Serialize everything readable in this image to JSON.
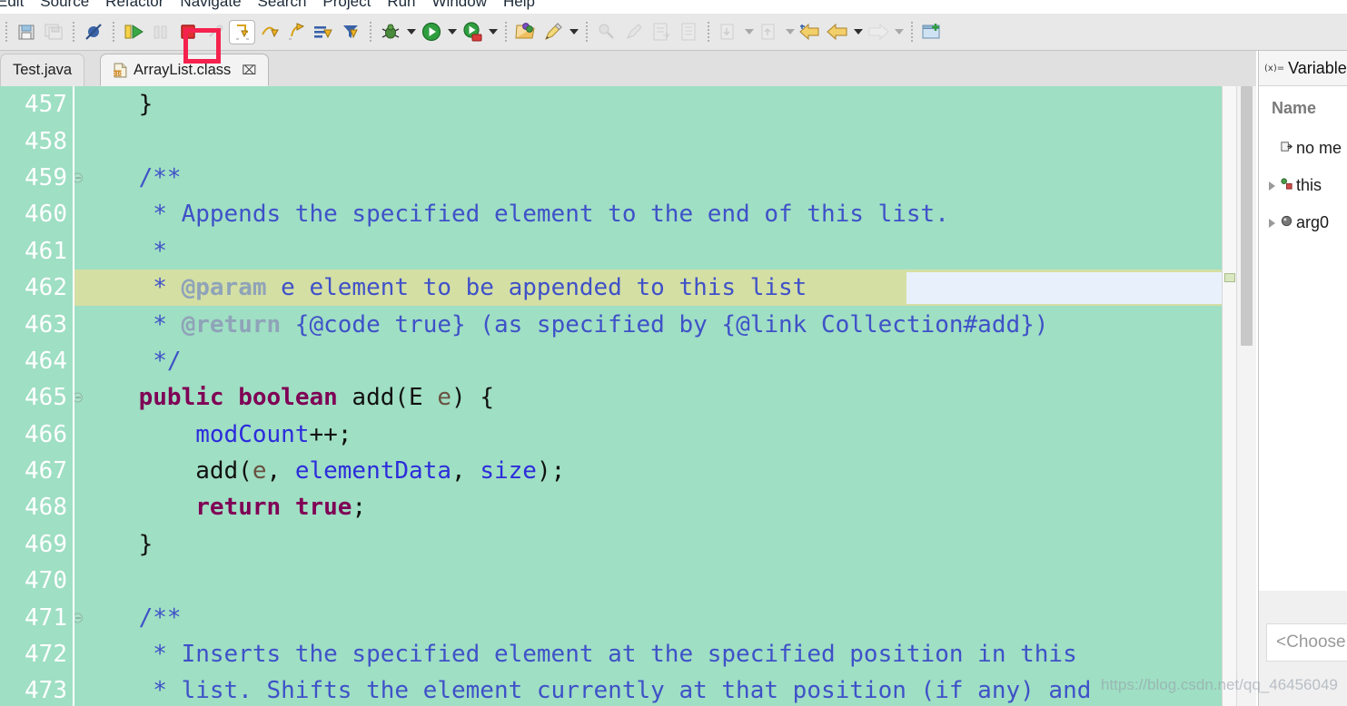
{
  "menu": {
    "items": [
      "Edit",
      "Source",
      "Refactor",
      "Navigate",
      "Search",
      "Project",
      "Run",
      "Window",
      "Help"
    ]
  },
  "toolbar": {
    "groups": [
      {
        "buttons": [
          {
            "name": "save-button",
            "icon": "save-icon",
            "enabled": true
          },
          {
            "name": "save-all-button",
            "icon": "save-all-icon",
            "enabled": false
          }
        ]
      },
      {
        "buttons": [
          {
            "name": "skip-all-breakpoints-button",
            "icon": "skip-breakpoints-icon",
            "enabled": true
          }
        ]
      },
      {
        "buttons": [
          {
            "name": "resume-button",
            "icon": "resume-icon",
            "enabled": true
          },
          {
            "name": "suspend-button",
            "icon": "suspend-icon",
            "enabled": false
          },
          {
            "name": "terminate-button",
            "icon": "terminate-icon",
            "enabled": true
          },
          {
            "name": "disconnect-button",
            "icon": "disconnect-icon",
            "enabled": false
          },
          {
            "name": "step-into-button",
            "icon": "step-into-icon",
            "enabled": true,
            "highlighted": true
          },
          {
            "name": "step-over-button",
            "icon": "step-over-icon",
            "enabled": true
          },
          {
            "name": "step-return-button",
            "icon": "step-return-icon",
            "enabled": true
          },
          {
            "name": "drop-to-frame-button",
            "icon": "drop-to-frame-icon",
            "enabled": true
          },
          {
            "name": "use-step-filters-button",
            "icon": "step-filters-icon",
            "enabled": true
          }
        ]
      },
      {
        "buttons": [
          {
            "name": "debug-button",
            "icon": "debug-bug-icon",
            "enabled": true,
            "dropdown": true
          },
          {
            "name": "run-button",
            "icon": "run-green-play-icon",
            "enabled": true,
            "dropdown": true
          },
          {
            "name": "coverage-button",
            "icon": "coverage-icon",
            "enabled": true,
            "dropdown": true
          }
        ]
      },
      {
        "buttons": [
          {
            "name": "open-type-button",
            "icon": "open-type-icon",
            "enabled": true
          },
          {
            "name": "external-tools-button",
            "icon": "external-tools-icon",
            "enabled": true,
            "dropdown": true
          }
        ]
      },
      {
        "buttons": [
          {
            "name": "new-java-project-button",
            "icon": "new-project-icon",
            "enabled": false
          },
          {
            "name": "search-button",
            "icon": "search-pencil-icon",
            "enabled": false
          },
          {
            "name": "open-task-button",
            "icon": "open-task-icon",
            "enabled": false
          },
          {
            "name": "toggle-markers-button",
            "icon": "markers-icon",
            "enabled": false
          }
        ]
      },
      {
        "buttons": [
          {
            "name": "next-annotation-button",
            "icon": "next-annotation-icon",
            "enabled": false,
            "dropdown": true
          },
          {
            "name": "previous-annotation-button",
            "icon": "previous-annotation-icon",
            "enabled": false,
            "dropdown": true
          },
          {
            "name": "last-edit-location-button",
            "icon": "last-edit-location-icon",
            "enabled": true
          },
          {
            "name": "back-button",
            "icon": "back-arrow-icon",
            "enabled": true,
            "dropdown": true
          },
          {
            "name": "forward-button",
            "icon": "forward-arrow-icon",
            "enabled": false,
            "dropdown": true
          }
        ]
      },
      {
        "buttons": [
          {
            "name": "new-window-button",
            "icon": "new-window-icon",
            "enabled": true
          }
        ]
      }
    ]
  },
  "tabs": [
    {
      "label": "Test.java",
      "active": false,
      "closable": false,
      "icon": null
    },
    {
      "label": "ArrayList.class",
      "active": true,
      "closable": true,
      "close_glyph": "⌧",
      "icon": "class-file-icon"
    }
  ],
  "window_controls": {
    "minimize": "minimize-icon",
    "maximize": "maximize-icon"
  },
  "editor": {
    "first_line": 457,
    "current_line": 462,
    "lines": [
      {
        "n": 457,
        "fold": false,
        "tokens": [
          {
            "t": "    ",
            "c": "plain"
          },
          {
            "t": "}",
            "c": "brace"
          }
        ]
      },
      {
        "n": 458,
        "fold": false,
        "tokens": []
      },
      {
        "n": 459,
        "fold": true,
        "tokens": [
          {
            "t": "    ",
            "c": "plain"
          },
          {
            "t": "/**",
            "c": "cmt"
          }
        ]
      },
      {
        "n": 460,
        "fold": false,
        "tokens": [
          {
            "t": "     * Appends the specified element to the end of this list.",
            "c": "cmt"
          }
        ]
      },
      {
        "n": 461,
        "fold": false,
        "tokens": [
          {
            "t": "     *",
            "c": "cmt"
          }
        ]
      },
      {
        "n": 462,
        "fold": false,
        "tokens": [
          {
            "t": "     * ",
            "c": "cmt"
          },
          {
            "t": "@param",
            "c": "cmt-tag"
          },
          {
            "t": " e element to be appended to this list",
            "c": "cmt"
          }
        ]
      },
      {
        "n": 463,
        "fold": false,
        "tokens": [
          {
            "t": "     * ",
            "c": "cmt"
          },
          {
            "t": "@return",
            "c": "cmt-tag"
          },
          {
            "t": " {@code true} (as specified by {@link Collection#add})",
            "c": "cmt"
          }
        ]
      },
      {
        "n": 464,
        "fold": false,
        "tokens": [
          {
            "t": "     */",
            "c": "cmt"
          }
        ]
      },
      {
        "n": 465,
        "fold": true,
        "tokens": [
          {
            "t": "    ",
            "c": "plain"
          },
          {
            "t": "public",
            "c": "kw"
          },
          {
            "t": " ",
            "c": "plain"
          },
          {
            "t": "boolean",
            "c": "kw"
          },
          {
            "t": " add(E ",
            "c": "plain"
          },
          {
            "t": "e",
            "c": "param"
          },
          {
            "t": ") {",
            "c": "plain"
          }
        ]
      },
      {
        "n": 466,
        "fold": false,
        "tokens": [
          {
            "t": "        ",
            "c": "plain"
          },
          {
            "t": "modCount",
            "c": "fld"
          },
          {
            "t": "++;",
            "c": "plain"
          }
        ]
      },
      {
        "n": 467,
        "fold": false,
        "tokens": [
          {
            "t": "        add(",
            "c": "plain"
          },
          {
            "t": "e",
            "c": "param"
          },
          {
            "t": ", ",
            "c": "plain"
          },
          {
            "t": "elementData",
            "c": "fld"
          },
          {
            "t": ", ",
            "c": "plain"
          },
          {
            "t": "size",
            "c": "fld"
          },
          {
            "t": ");",
            "c": "plain"
          }
        ]
      },
      {
        "n": 468,
        "fold": false,
        "tokens": [
          {
            "t": "        ",
            "c": "plain"
          },
          {
            "t": "return",
            "c": "kw"
          },
          {
            "t": " ",
            "c": "plain"
          },
          {
            "t": "true",
            "c": "kw"
          },
          {
            "t": ";",
            "c": "plain"
          }
        ]
      },
      {
        "n": 469,
        "fold": false,
        "tokens": [
          {
            "t": "    ",
            "c": "plain"
          },
          {
            "t": "}",
            "c": "brace"
          }
        ]
      },
      {
        "n": 470,
        "fold": false,
        "tokens": []
      },
      {
        "n": 471,
        "fold": true,
        "tokens": [
          {
            "t": "    ",
            "c": "plain"
          },
          {
            "t": "/**",
            "c": "cmt"
          }
        ]
      },
      {
        "n": 472,
        "fold": false,
        "tokens": [
          {
            "t": "     * Inserts the specified element at the specified position in this",
            "c": "cmt"
          }
        ]
      },
      {
        "n": 473,
        "fold": false,
        "tokens": [
          {
            "t": "     * list. Shifts the element currently at that position (if any) and",
            "c": "cmt"
          }
        ]
      }
    ],
    "colors": {
      "background": "#9fdfc4",
      "current_line": "#d4dfa4",
      "selection": "#e8f1fb",
      "line_number": "#ffffff",
      "keyword": "#7f0055",
      "comment": "#3f51c8",
      "javadoc_tag": "#8fa3b8",
      "field": "#2c2cdb",
      "parameter": "#6a5140"
    }
  },
  "variables_panel": {
    "tab_icon_label": "(x)=",
    "tab_title": "Variable",
    "column_header": "Name",
    "rows": [
      {
        "label": "no me",
        "icon": "return-value-icon",
        "expandable": false
      },
      {
        "label": "this",
        "icon": "object-this-icon",
        "expandable": true
      },
      {
        "label": "arg0",
        "icon": "argument-icon",
        "expandable": true
      }
    ],
    "detail_placeholder": "<Choose"
  },
  "watermark": "https://blog.csdn.net/qq_46456049"
}
